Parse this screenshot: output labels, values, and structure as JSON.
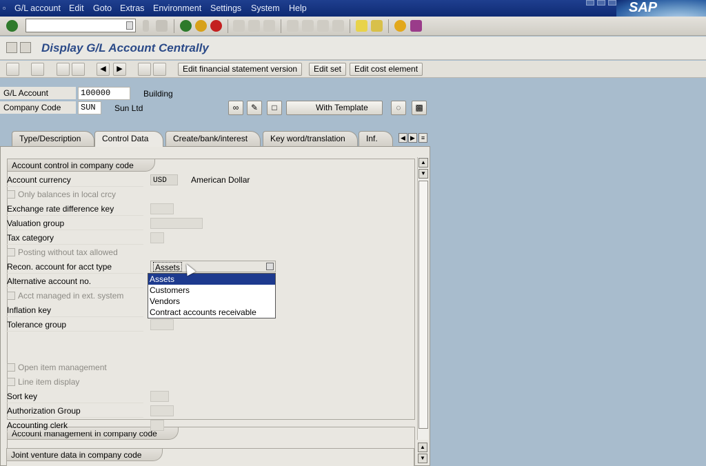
{
  "menu": [
    "G/L account",
    "Edit",
    "Goto",
    "Extras",
    "Environment",
    "Settings",
    "System",
    "Help"
  ],
  "logo_text": "SAP",
  "title": "Display G/L Account Centrally",
  "app_toolbar": {
    "edit_fs_version": "Edit financial statement version",
    "edit_set": "Edit set",
    "edit_cost_element": "Edit cost element"
  },
  "header": {
    "gl_account_label": "G/L Account",
    "gl_account_value": "100000",
    "gl_account_desc": "Building",
    "company_code_label": "Company Code",
    "company_code_value": "SUN",
    "company_code_desc": "Sun Ltd",
    "with_template": "With Template"
  },
  "tabs": [
    "Type/Description",
    "Control Data",
    "Create/bank/interest",
    "Key word/translation",
    "Inf."
  ],
  "active_tab": "Control Data",
  "account_control": {
    "title": "Account control in company code",
    "account_currency_label": "Account currency",
    "account_currency_value": "USD",
    "account_currency_desc": "American Dollar",
    "only_balances": "Only balances in local crcy",
    "exchange_rate_key": "Exchange rate difference key",
    "valuation_group": "Valuation group",
    "tax_category": "Tax category",
    "posting_without_tax": "Posting without tax allowed",
    "recon_account": "Recon. account for acct type",
    "recon_value": "Assets",
    "alt_account": "Alternative account no.",
    "acct_managed_ext": "Acct managed in ext. system",
    "inflation_key": "Inflation key",
    "tolerance_group": "Tolerance group"
  },
  "dropdown_options": [
    "Assets",
    "Customers",
    "Vendors",
    "Contract accounts receivable"
  ],
  "account_management": {
    "title": "Account management in company code",
    "open_item": "Open item management",
    "line_item": "Line item display",
    "sort_key": "Sort key",
    "authorization_group": "Authorization Group",
    "accounting_clerk": "Accounting clerk"
  },
  "joint_venture": {
    "title": "Joint venture data in company code"
  }
}
